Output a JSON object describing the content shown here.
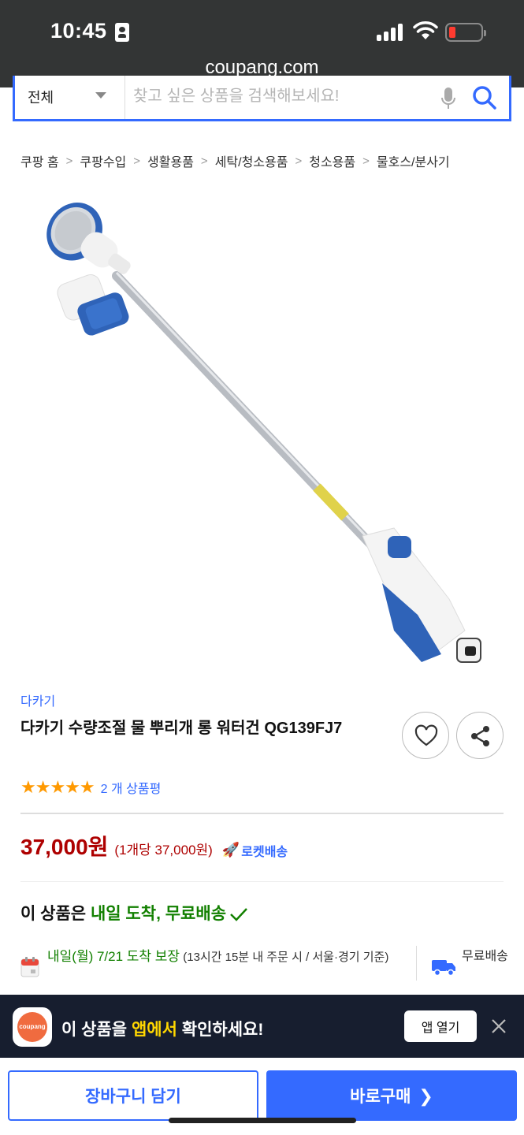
{
  "status_bar": {
    "time": "10:45"
  },
  "browser": {
    "url": "coupang.com"
  },
  "search": {
    "category": "전체",
    "placeholder": "찾고 싶은 상품을 검색해보세요!"
  },
  "breadcrumb": [
    "쿠팡 홈",
    "쿠팡수입",
    "생활용품",
    "세탁/청소용품",
    "청소용품",
    "물호스/분사기"
  ],
  "product": {
    "brand": "다카기",
    "title": "다카기 수량조절 물 뿌리개 롱 워터건 QG139FJ7",
    "rating_stars": 5,
    "review_count": "2 개 상품평",
    "price": "37,000원",
    "unit_price": "(1개당 37,000원)",
    "rocket_label": "로켓배송"
  },
  "delivery": {
    "headline_prefix": "이 상품은 ",
    "headline_highlight": "내일 도착, 무료배송",
    "arrival_highlight": "내일(월) 7/21 도착 보장",
    "arrival_note": " (13시간 15분 내 주문 시 / 서울·경기 기준)",
    "shipping": "무료배송"
  },
  "app_banner": {
    "logo_text": "coupang",
    "text_prefix": "이 상품을 ",
    "text_highlight": "앱에서",
    "text_suffix": " 확인하세요!",
    "open_label": "앱 열기"
  },
  "actions": {
    "cart_label": "장바구니 담기",
    "buy_label": "바로구매"
  },
  "colors": {
    "accent": "#346aff",
    "price": "#ae0000",
    "green": "#128000",
    "star": "#ff9900",
    "banner": "#171e2f"
  }
}
